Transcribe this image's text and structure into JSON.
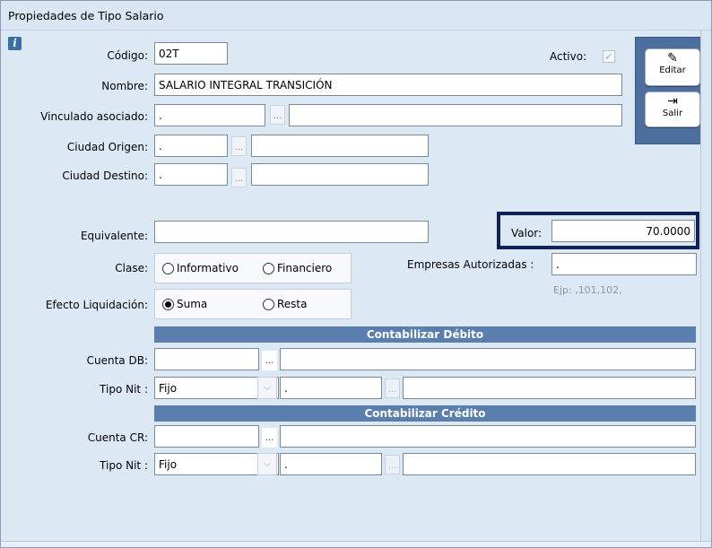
{
  "window": {
    "title": "Propiedades de Tipo Salario"
  },
  "form": {
    "codigo_label": "Código:",
    "codigo_value": "02T",
    "activo_label": "Activo:",
    "activo_check": "✓",
    "nombre_label": "Nombre:",
    "nombre_value": "SALARIO INTEGRAL TRANSICIÓN",
    "vinculado_label": "Vinculado asociado:",
    "vinculado_value": ".",
    "ciudad_origen_label": "Ciudad Origen:",
    "ciudad_origen_value": ".",
    "ciudad_destino_label": "Ciudad Destino:",
    "ciudad_destino_value": ".",
    "equivalente_label": "Equivalente:",
    "equivalente_value": "",
    "valor_label": "Valor:",
    "valor_value": "70.0000",
    "clase_label": "Clase:",
    "clase_opt1": "Informativo",
    "clase_opt2": "Financiero",
    "empresas_label": "Empresas Autorizadas :",
    "empresas_value": ".",
    "empresas_hint": "Ejp: ,101,102,",
    "efecto_label": "Efecto Liquidación:",
    "efecto_opt1": "Suma",
    "efecto_opt2": "Resta",
    "dots": "..."
  },
  "debito": {
    "header": "Contabilizar Débito",
    "cuenta_label": "Cuenta DB:",
    "tipo_label": "Tipo Nit :",
    "tipo_value": "Fijo",
    "nit_value": "."
  },
  "credito": {
    "header": "Contabilizar Crédito",
    "cuenta_label": "Cuenta CR:",
    "tipo_label": "Tipo Nit :",
    "tipo_value": "Fijo",
    "nit_value": "."
  },
  "toolbar": {
    "editar_label": "Editar",
    "editar_icon": "edit-icon",
    "salir_label": "Salir",
    "salir_icon": "exit-icon"
  },
  "colors": {
    "section_header": "#5a7fae",
    "toolbar_panel": "#4d6f9e",
    "focus_frame": "#0f2253",
    "background": "#dde8f5"
  }
}
